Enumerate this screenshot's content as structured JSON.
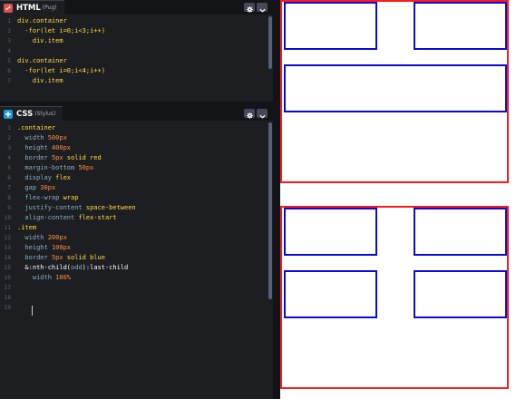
{
  "html_panel": {
    "title": "HTML",
    "preprocessor": "(Pug)",
    "icon": "html-icon",
    "accent": "#e34c4c",
    "lines": [
      [
        {
          "t": "div.container",
          "c": "sel"
        }
      ],
      [
        {
          "t": "  -for(let i=0;i<3;i++)",
          "c": "kw"
        }
      ],
      [
        {
          "t": "    div.item",
          "c": "sel"
        }
      ],
      [],
      [
        {
          "t": "div.container",
          "c": "sel"
        }
      ],
      [
        {
          "t": "  -for(let i=0;i<4;i++)",
          "c": "kw"
        }
      ],
      [
        {
          "t": "    div.item",
          "c": "sel"
        }
      ]
    ]
  },
  "css_panel": {
    "title": "CSS",
    "preprocessor": "(Stylus)",
    "icon": "css-icon",
    "accent": "#1c9cd8",
    "lines": [
      [
        {
          "t": ".container",
          "c": "sel"
        }
      ],
      [
        {
          "t": "  width ",
          "c": "prop"
        },
        {
          "t": "500px",
          "c": "num"
        }
      ],
      [
        {
          "t": "  height ",
          "c": "prop"
        },
        {
          "t": "400px",
          "c": "num"
        }
      ],
      [
        {
          "t": "  border ",
          "c": "prop"
        },
        {
          "t": "5px",
          "c": "num"
        },
        {
          "t": " solid red",
          "c": "kw"
        }
      ],
      [
        {
          "t": "  margin-bottom ",
          "c": "prop"
        },
        {
          "t": "50px",
          "c": "num"
        }
      ],
      [
        {
          "t": "  display ",
          "c": "prop"
        },
        {
          "t": "flex",
          "c": "kw"
        }
      ],
      [
        {
          "t": "  gap ",
          "c": "prop"
        },
        {
          "t": "30px",
          "c": "num"
        }
      ],
      [
        {
          "t": "  flex-wrap ",
          "c": "prop"
        },
        {
          "t": "wrap",
          "c": "kw"
        }
      ],
      [
        {
          "t": "  justify-content ",
          "c": "prop"
        },
        {
          "t": "space-between",
          "c": "kw"
        }
      ],
      [
        {
          "t": "  align-content ",
          "c": "prop"
        },
        {
          "t": "flex-start",
          "c": "kw"
        }
      ],
      [
        {
          "t": ".item",
          "c": "sel"
        }
      ],
      [
        {
          "t": "  width ",
          "c": "prop"
        },
        {
          "t": "200px",
          "c": "num"
        }
      ],
      [
        {
          "t": "  height ",
          "c": "prop"
        },
        {
          "t": "100px",
          "c": "num"
        }
      ],
      [
        {
          "t": "  border ",
          "c": "prop"
        },
        {
          "t": "5px",
          "c": "num"
        },
        {
          "t": " solid blue",
          "c": "kw"
        }
      ],
      [
        {
          "t": "  &:nth-child(",
          "c": "plain"
        },
        {
          "t": "odd",
          "c": "dim"
        },
        {
          "t": "):last-child",
          "c": "plain"
        }
      ],
      [
        {
          "t": "    width ",
          "c": "prop"
        },
        {
          "t": "100%",
          "c": "num"
        }
      ],
      [],
      [],
      []
    ]
  },
  "header_buttons": {
    "settings_icon": "gear-icon",
    "collapse_icon": "chevron-down-icon"
  },
  "preview": {
    "container_border_color": "#ff1a1a",
    "item_border_color": "#0a0adb",
    "containers": [
      {
        "item_count": 3
      },
      {
        "item_count": 4
      }
    ]
  }
}
